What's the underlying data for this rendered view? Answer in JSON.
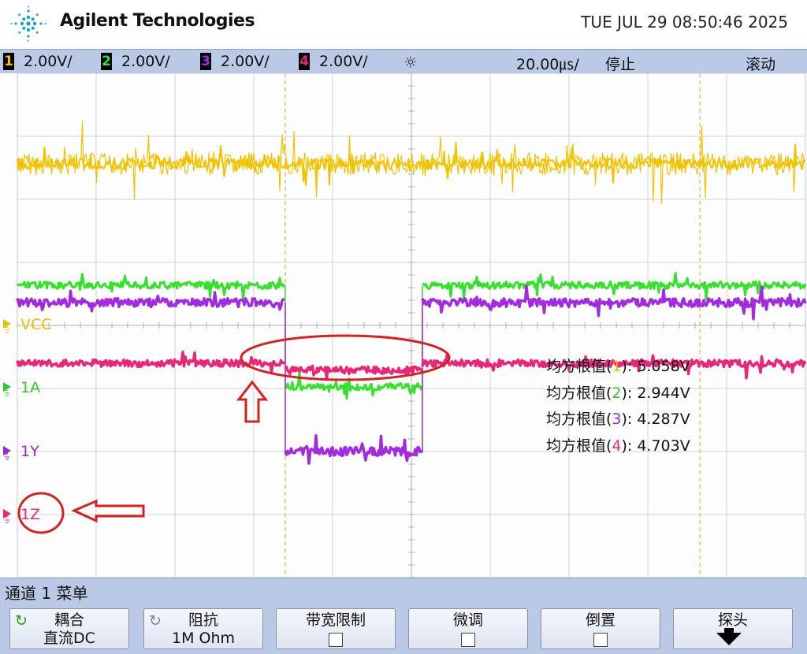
{
  "header": {
    "brand": "Agilent Technologies",
    "datetime": "TUE JUL 29 08:50:46 2025"
  },
  "statusbar": {
    "channels": [
      {
        "number": "1",
        "scale": "2.00V/",
        "color": "#f2c200"
      },
      {
        "number": "2",
        "scale": "2.00V/",
        "color": "#38e02e"
      },
      {
        "number": "3",
        "scale": "2.00V/",
        "color": "#a22be0"
      },
      {
        "number": "4",
        "scale": "2.00V/",
        "color": "#e8267a"
      }
    ],
    "trigger_icon": "☼",
    "timebase": "20.00㎲/",
    "run_state": "停止",
    "mode": "滚动"
  },
  "channel_labels": [
    {
      "marker": "1",
      "label": "VCC",
      "color": "#e6c100"
    },
    {
      "marker": "2",
      "label": "1A",
      "color": "#35c92d"
    },
    {
      "marker": "3",
      "label": "1Y",
      "color": "#9a2ad6"
    },
    {
      "marker": "4",
      "label": "1Z",
      "color": "#e8267a"
    }
  ],
  "measurements": [
    {
      "label": "均方根值(",
      "channel": "1",
      "suffix": "):",
      "value": "5.058V",
      "color": "#e6c100"
    },
    {
      "label": "均方根值(",
      "channel": "2",
      "suffix": "):",
      "value": "2.944V",
      "color": "#35c92d"
    },
    {
      "label": "均方根值(",
      "channel": "3",
      "suffix": "):",
      "value": "4.287V",
      "color": "#9a2ad6"
    },
    {
      "label": "均方根值(",
      "channel": "4",
      "suffix": "):",
      "value": "4.703V",
      "color": "#e8267a"
    }
  ],
  "annotations": {
    "color": "#d22222"
  },
  "menu": {
    "title": "通道 1 菜单",
    "softkeys": [
      {
        "line1": "耦合",
        "line2": "直流DC",
        "icon": "rotate-icon"
      },
      {
        "line1": "阻抗",
        "line2": "1M Ohm",
        "icon": "rotate-icon"
      },
      {
        "line1": "带宽限制",
        "icon": "checkbox-icon"
      },
      {
        "line1": "微调",
        "icon": "checkbox-icon"
      },
      {
        "line1": "倒置",
        "icon": "checkbox-icon"
      },
      {
        "line1": "探头",
        "icon": "down-arrow-icon"
      }
    ],
    "rotate_glyph": "↻"
  }
}
